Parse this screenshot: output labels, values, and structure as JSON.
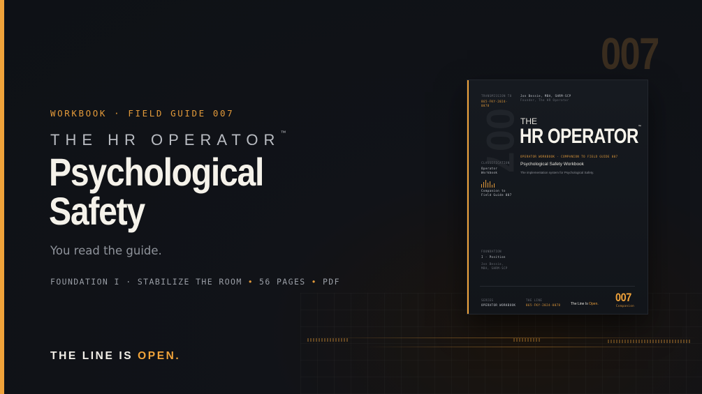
{
  "colors": {
    "accent": "#f0a33a",
    "background": "#0e1116",
    "text": "#f2efe8",
    "muted": "#8f939b"
  },
  "hero": {
    "eyebrow": "WORKBOOK · FIELD GUIDE 007",
    "brand": "THE HR OPERATOR",
    "brand_mark": "™",
    "title_line1": "Psychological",
    "title_line2": "Safety",
    "subtitle": "You read the guide.",
    "meta": [
      "FOUNDATION I · STABILIZE THE ROOM",
      "56 PAGES",
      "PDF"
    ],
    "tagline_prefix": "THE LINE IS",
    "tagline_highlight": "OPEN."
  },
  "big_number": "007",
  "cover": {
    "transmission_label": "TRANSMISSION TO",
    "transmission_value_line1": "865-FKY-2024-",
    "transmission_value_line2": "0078",
    "author_name": "Jon Bessie, MBA, SHRM-SCP",
    "author_sub": "Founder, The HR Operator",
    "the": "THE",
    "title": "HR OPERATOR",
    "tm": "™",
    "kicker": "OPERATOR WORKBOOK · COMPANION TO FIELD GUIDE 007",
    "subtitle": "Psychological Safety Workbook",
    "description": "The implementation system for Psychological Safety.",
    "classification_label": "CLASSIFICATION",
    "classification_line1": "Operator",
    "classification_line2": "Workbook",
    "companion_line1": "Companion to",
    "companion_line2": "Field Guide 007",
    "foundation_label": "FOUNDATION",
    "foundation_value": "I · Position",
    "signoff_line1": "Jon Bessie,",
    "signoff_line2": "MBA, SHRM-SCP",
    "series_label": "SERIES",
    "series_value": "OPERATOR WORKBOOK",
    "line_label": "THE LINE",
    "line_value": "865-FKY-2024-0078",
    "line_prefix": "The Line Is",
    "line_highlight": "Open.",
    "number": "007",
    "number_sub": "Companion",
    "watermark": "007"
  }
}
